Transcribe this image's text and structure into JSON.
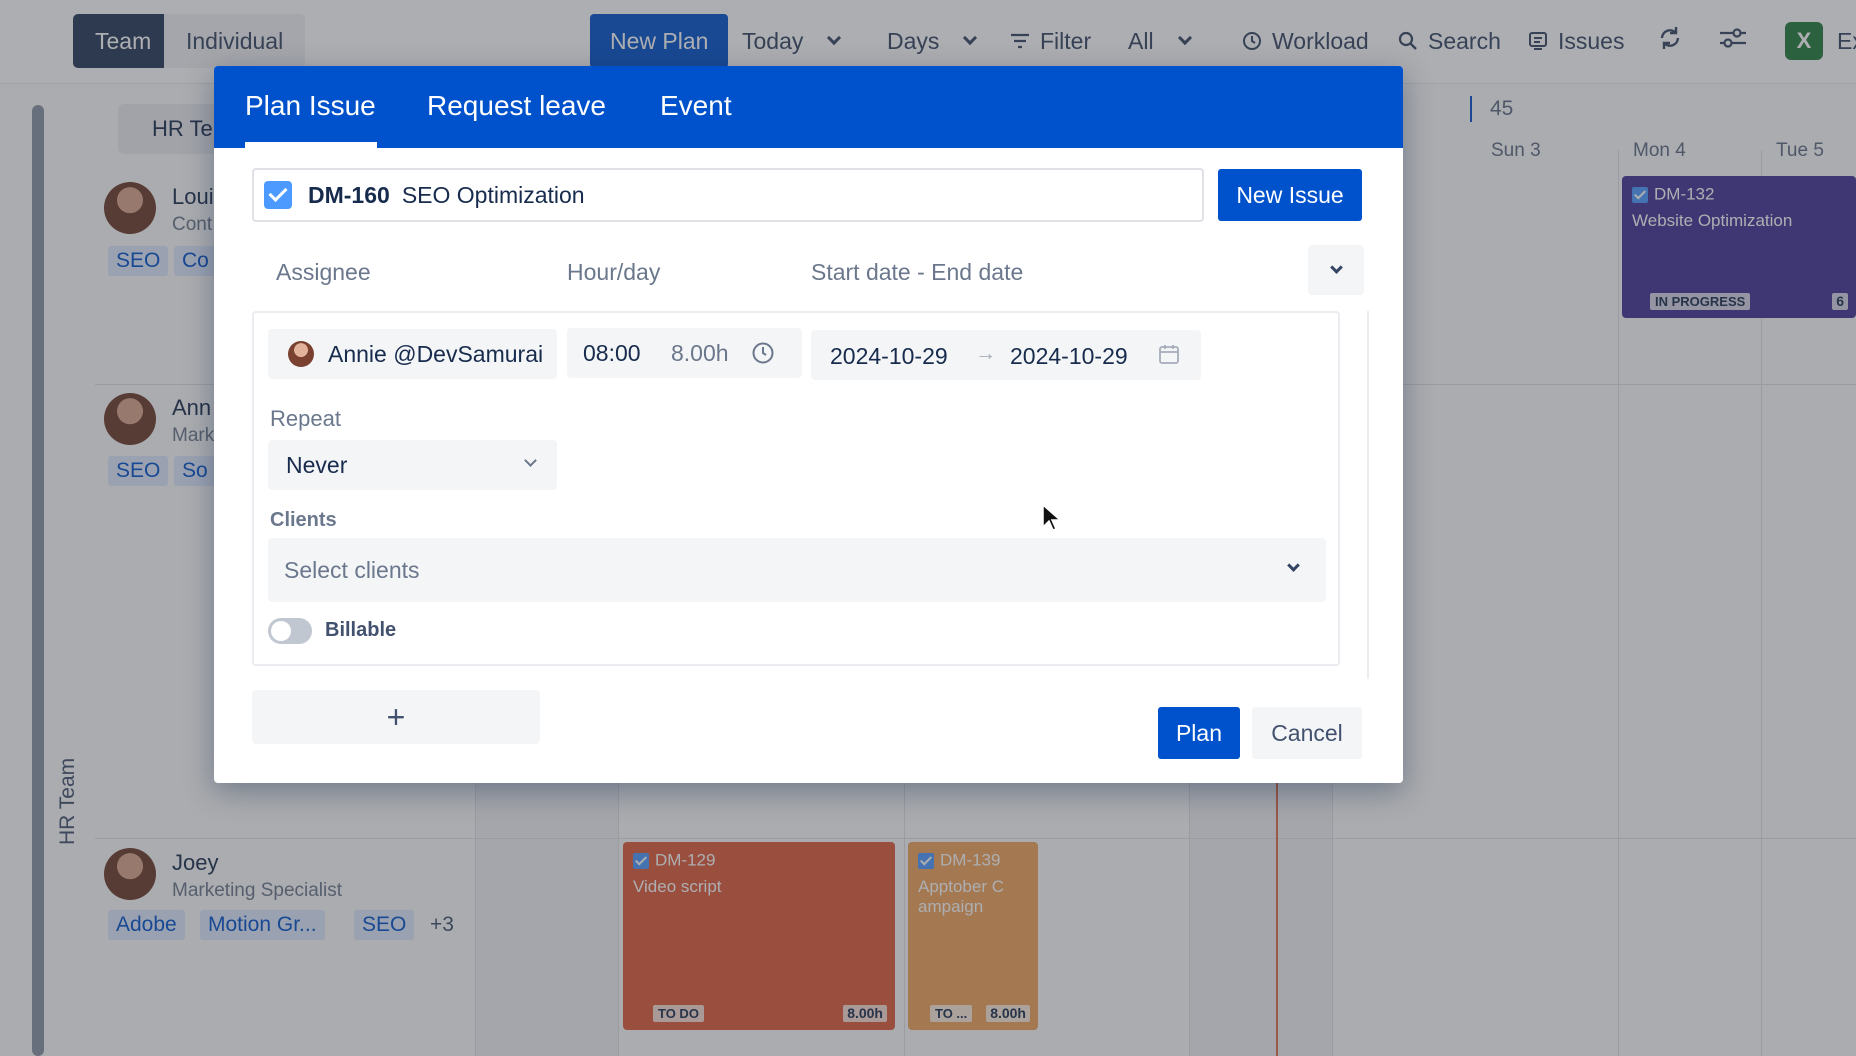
{
  "topbar": {
    "view_team": "Team",
    "view_individual": "Individual",
    "new_plan": "New Plan",
    "today": "Today",
    "range": "Days",
    "filter": "Filter",
    "filter_value": "All",
    "workload": "Workload",
    "search": "Search",
    "issues": "Issues",
    "export_label": "Ex"
  },
  "timeline": {
    "team_tab": "HR Te",
    "week_number": "45",
    "days": [
      "Sun 3",
      "Mon 4",
      "Tue 5"
    ],
    "group_label": "HR Team"
  },
  "people": [
    {
      "name": "Loui",
      "role": "Cont",
      "tags": [
        "SEO",
        "Co"
      ]
    },
    {
      "name": "Ann",
      "role": "Mark",
      "tags": [
        "SEO",
        "So"
      ]
    },
    {
      "name": "Joey",
      "role": "Marketing Specialist",
      "tags": [
        "Adobe",
        "Motion Gr...",
        "SEO",
        "+3"
      ]
    }
  ],
  "cards": [
    {
      "key": "DM-132",
      "title": "Website Optimization",
      "status": "IN PROGRESS",
      "hours": "6",
      "color": "#403294"
    },
    {
      "key": "DM-129",
      "title": "Video script",
      "status": "TO DO",
      "hours": "8.00h",
      "color": "#de5b3a"
    },
    {
      "key": "DM-139",
      "title": "Apptober C ampaign",
      "status": "TO ...",
      "hours": "8.00h",
      "color": "#f0a35a"
    }
  ],
  "modal": {
    "tabs": [
      "Plan Issue",
      "Request leave",
      "Event"
    ],
    "issue": {
      "key": "DM-160",
      "title": "SEO Optimization"
    },
    "new_issue_button": "New Issue",
    "columns": {
      "assignee": "Assignee",
      "hour_day": "Hour/day",
      "dates": "Start date - End date"
    },
    "assignee": "Annie @DevSamurai",
    "start_time": "08:00",
    "hours": "8.00h",
    "start_date": "2024-10-29",
    "date_arrow": "→",
    "end_date": "2024-10-29",
    "repeat_label": "Repeat",
    "repeat_value": "Never",
    "clients_label": "Clients",
    "clients_placeholder": "Select clients",
    "billable_label": "Billable",
    "billable_on": false,
    "add_label": "+",
    "plan_button": "Plan",
    "cancel_button": "Cancel"
  },
  "colors": {
    "primary": "#0052cc",
    "header": "#0052cc",
    "tag_bg": "#deebff"
  }
}
